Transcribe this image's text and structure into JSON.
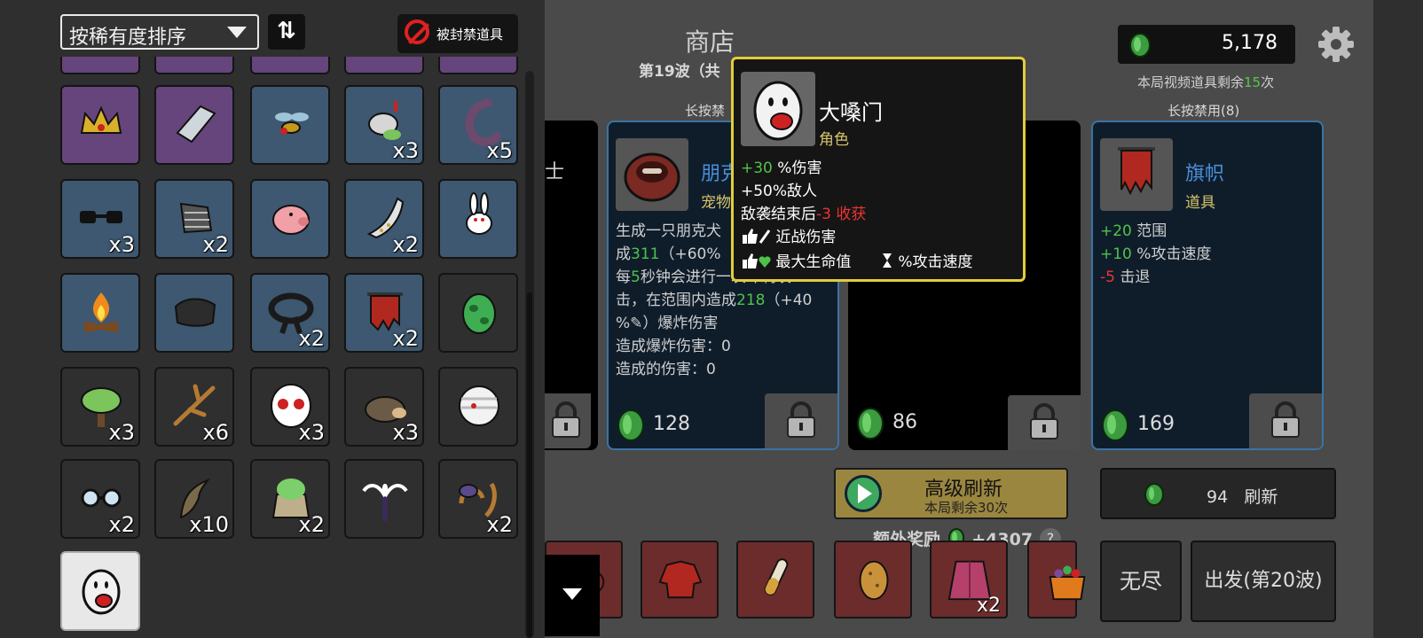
{
  "inventory": {
    "sort_label": "按稀有度排序",
    "sort_direction_icon": "⇅",
    "ban_button_label": "被封禁道具",
    "items": [
      {
        "icon": "crown-icon",
        "bg": "purple",
        "count": ""
      },
      {
        "icon": "whetstone-icon",
        "bg": "purple",
        "count": ""
      },
      {
        "icon": "wasp-icon",
        "bg": "blue",
        "count": ""
      },
      {
        "icon": "drooling-creature-icon",
        "bg": "blue",
        "count": "x3"
      },
      {
        "icon": "tentacle-icon",
        "bg": "blue",
        "count": "x5"
      },
      {
        "icon": "sunglasses-icon",
        "bg": "blue",
        "count": "x3"
      },
      {
        "icon": "glove-icon",
        "bg": "blue",
        "count": "x2"
      },
      {
        "icon": "piggy-bank-icon",
        "bg": "blue",
        "count": ""
      },
      {
        "icon": "blade-icon",
        "bg": "blue",
        "count": "x2"
      },
      {
        "icon": "rabbit-icon",
        "bg": "blue",
        "count": ""
      },
      {
        "icon": "campfire-icon",
        "bg": "blue",
        "count": ""
      },
      {
        "icon": "scarf-icon",
        "bg": "blue",
        "count": ""
      },
      {
        "icon": "black-belt-icon",
        "bg": "blue",
        "count": "x2"
      },
      {
        "icon": "banner-icon",
        "bg": "blue",
        "count": "x2"
      },
      {
        "icon": "green-egg-icon",
        "bg": "dark",
        "count": ""
      },
      {
        "icon": "tree-icon",
        "bg": "dark",
        "count": "x3"
      },
      {
        "icon": "twig-icon",
        "bg": "dark",
        "count": "x6"
      },
      {
        "icon": "ghost-mask-icon",
        "bg": "dark",
        "count": "x3"
      },
      {
        "icon": "hedgehog-icon",
        "bg": "dark",
        "count": "x3"
      },
      {
        "icon": "bandaged-head-icon",
        "bg": "dark",
        "count": ""
      },
      {
        "icon": "glasses-icon",
        "bg": "dark",
        "count": "x2"
      },
      {
        "icon": "scythe-icon",
        "bg": "dark",
        "count": "x10"
      },
      {
        "icon": "herb-sack-icon",
        "bg": "dark",
        "count": "x2"
      },
      {
        "icon": "palm-tree-icon",
        "bg": "dark",
        "count": ""
      },
      {
        "icon": "mushroom-icon",
        "bg": "dark",
        "count": "x2"
      },
      {
        "icon": "loudmouth-icon",
        "bg": "sel",
        "count": ""
      }
    ]
  },
  "shop": {
    "title": "商店",
    "wave_text": "第19波（共",
    "coins": "5,178",
    "video_left_prefix": "本局视频道具剩余",
    "video_left_count": "15",
    "video_left_suffix": "次",
    "ban_label_2": "长按禁",
    "ban_label_4": "长按禁用(8)",
    "card1_partial_char": "士",
    "cards": [
      {
        "name": "朋克",
        "type": "宠物",
        "icon": "dog-bowl-icon",
        "price": "128",
        "desc": [
          [
            {
              "t": "生成一只朋克犬"
            }
          ],
          [
            {
              "t": "成"
            },
            {
              "t": "311",
              "c": "g"
            },
            {
              "t": "（+60%"
            }
          ],
          [
            {
              "t": "每"
            },
            {
              "t": "5",
              "c": "g"
            },
            {
              "t": "秒钟会进行一次冲刺攻"
            }
          ],
          [
            {
              "t": "击，在范围内造成"
            },
            {
              "t": "218",
              "c": "g"
            },
            {
              "t": "（+40"
            }
          ],
          [
            {
              "t": "%"
            },
            {
              "t": "✎"
            },
            {
              "t": "）爆炸伤害"
            }
          ],
          [
            {
              "t": "造成爆炸伤害：0"
            }
          ],
          [
            {
              "t": "造成的伤害：0"
            }
          ]
        ]
      },
      {
        "price": "86"
      },
      {
        "name": "旗帜",
        "type": "道具",
        "icon": "banner-icon",
        "price": "169",
        "desc": [
          [
            {
              "t": "+20",
              "c": "g"
            },
            {
              "t": " 范围"
            }
          ],
          [
            {
              "t": "+10",
              "c": "g"
            },
            {
              "t": " %攻击速度"
            }
          ],
          [
            {
              "t": "-5",
              "c": "r"
            },
            {
              "t": " 击退"
            }
          ]
        ]
      }
    ],
    "advanced_refresh_label": "高级刷新",
    "advanced_refresh_sub": "本局剩余30次",
    "refresh_cost": "94",
    "refresh_label": "刷新",
    "bonus_label": "额外奖励",
    "bonus_value": "+4307",
    "bonus_help": "?",
    "owned": [
      {
        "icon": "dog-bowl-icon",
        "count": ""
      },
      {
        "icon": "hoodie-icon",
        "count": ""
      },
      {
        "icon": "test-tube-icon",
        "count": ""
      },
      {
        "icon": "potato-icon",
        "count": ""
      },
      {
        "icon": "cape-icon",
        "count": "x2"
      },
      {
        "icon": "candy-bucket-icon",
        "count": ""
      }
    ],
    "endless_label": "无尽",
    "depart_label": "出发(第20波)"
  },
  "tooltip": {
    "name": "大嗓门",
    "type": "角色",
    "line1_value": "+30",
    "line1_text": " %伤害",
    "line2_text": "+50%敌人",
    "line3_text": "敌袭结束后",
    "line3_value": "-3 收获",
    "tag1": "近战伤害",
    "tag2": "最大生命值",
    "tag3": "%攻击速度"
  },
  "colors": {
    "accent_green": "#4ec24a",
    "negative_red": "#e33333",
    "tooltip_border": "#e1cd3b",
    "card_border": "#3a73a5"
  }
}
